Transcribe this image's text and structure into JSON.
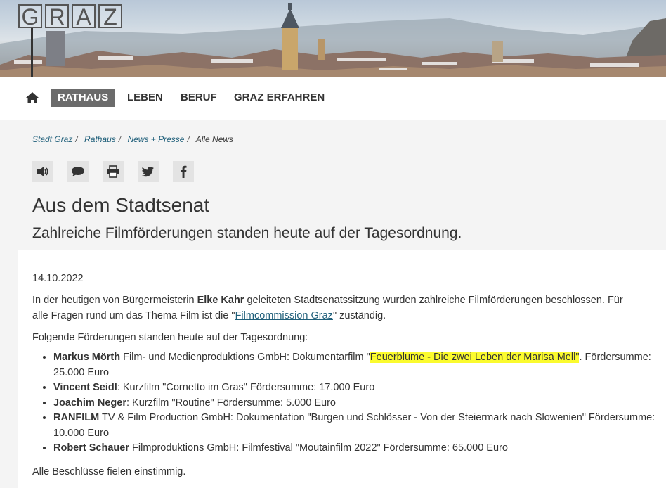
{
  "logo": [
    "G",
    "R",
    "A",
    "Z"
  ],
  "nav": {
    "items": [
      {
        "label": "RATHAUS",
        "active": true
      },
      {
        "label": "LEBEN"
      },
      {
        "label": "BERUF"
      },
      {
        "label": "GRAZ ERFAHREN"
      }
    ]
  },
  "breadcrumb": {
    "items": [
      "Stadt Graz",
      "Rathaus",
      "News + Presse"
    ],
    "separator": "/",
    "current": "Alle News"
  },
  "share": [
    "speaker-icon",
    "comment-icon",
    "print-icon",
    "twitter-icon",
    "facebook-icon"
  ],
  "article": {
    "title": "Aus dem Stadtsenat",
    "subtitle": "Zahlreiche Filmförderungen standen heute auf der Tagesordnung.",
    "date": "14.10.2022",
    "intro_1": "In der heutigen von Bürgermeisterin ",
    "intro_bold": "Elke Kahr",
    "intro_2": " geleiteten Stadtsenatssitzung wurden zahlreiche Filmförderungen beschlossen. Für alle Fragen rund um das Thema Film ist  die \"",
    "intro_link": "Filmcommission Graz",
    "intro_3": "\" zuständig.",
    "list_intro": "Folgende Förderungen standen heute auf der Tagesordnung:",
    "items": [
      {
        "bold": "Markus Mörth",
        "text_1": " Film- und Medienproduktions GmbH: Dokumentarfilm \"",
        "highlight": "Feuerblume - Die zwei Leben der Marisa Mell\"",
        "text_2": ". Fördersumme: 25.000 Euro"
      },
      {
        "bold": "Vincent Seidl",
        "text_1": ": Kurzfilm \"Cornetto im Gras\" Fördersumme: 17.000 Euro"
      },
      {
        "bold": "Joachim Neger",
        "text_1": ": Kurzfilm \"Routine\" Fördersumme: 5.000 Euro"
      },
      {
        "bold": "RANFILM",
        "text_1": " TV & Film Production GmbH: Dokumentation \"Burgen und Schlösser - Von der Steiermark nach Slowenien\" Fördersumme: 10.000 Euro"
      },
      {
        "bold": "Robert Schauer",
        "text_1": " Filmproduktions GmbH: Filmfestival \"Moutainfilm 2022\" Fördersumme: 65.000 Euro"
      }
    ],
    "closing": "Alle Beschlüsse fielen einstimmig."
  },
  "colors": {
    "link": "#1f5f7a",
    "nav_active_bg": "#6b6b6b",
    "highlight": "#fbfb2e"
  }
}
